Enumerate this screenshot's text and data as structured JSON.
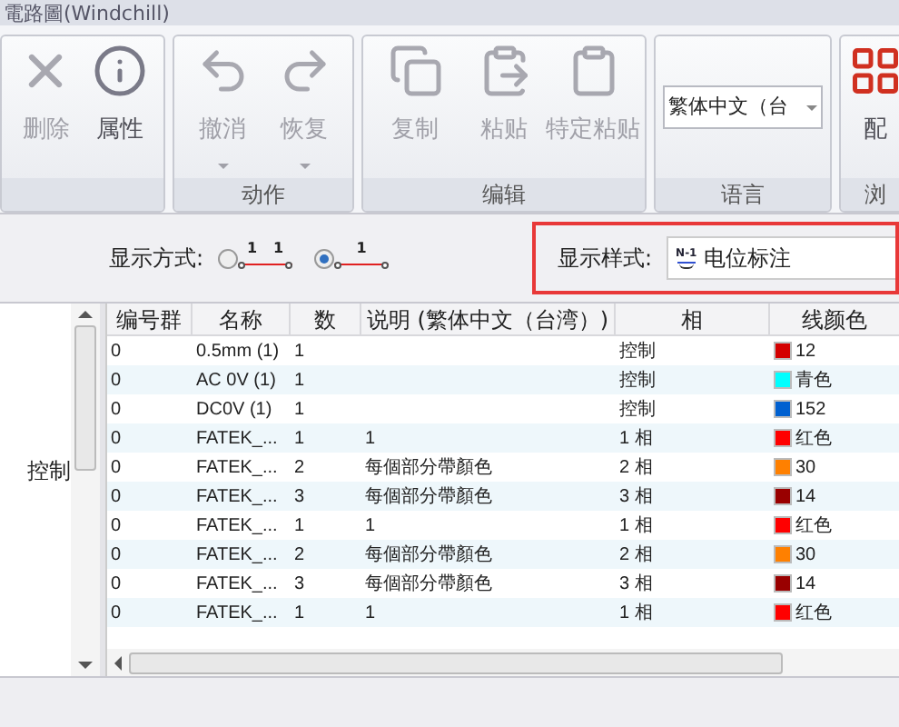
{
  "window": {
    "title": "電路圖(Windchill)"
  },
  "ribbon": {
    "groups": [
      {
        "buttons": [
          {
            "kind": "delete",
            "label": "删除",
            "menu": false,
            "disabled": true
          },
          {
            "kind": "info",
            "label": "属性",
            "menu": false,
            "disabled": false
          }
        ]
      },
      {
        "label": "动作",
        "buttons": [
          {
            "kind": "undo",
            "label": "撤消",
            "menu": true,
            "disabled": true
          },
          {
            "kind": "redo",
            "label": "恢复",
            "menu": true,
            "disabled": true
          }
        ]
      },
      {
        "label": "编辑",
        "buttons": [
          {
            "kind": "copy",
            "label": "复制",
            "menu": false,
            "disabled": true
          },
          {
            "kind": "paste",
            "label": "粘贴",
            "menu": false,
            "disabled": true
          },
          {
            "kind": "paste-special",
            "label": "特定粘贴",
            "menu": false,
            "disabled": true
          }
        ]
      },
      {
        "label": "语言",
        "select": "繁体中文（台"
      },
      {
        "label": "浏",
        "buttons": [
          {
            "kind": "config",
            "label": "配",
            "menu": false,
            "disabled": false
          }
        ]
      }
    ]
  },
  "display_mode": {
    "label": "显示方式:",
    "options": [
      {
        "labels": [
          "1",
          "1"
        ],
        "selected": false
      },
      {
        "labels": [
          "1"
        ],
        "selected": true
      }
    ]
  },
  "display_style": {
    "label": "显示样式:",
    "icon_label": "N-1",
    "value": "电位标注"
  },
  "sidebar": {
    "items": [
      {
        "label": "控制"
      }
    ]
  },
  "table": {
    "columns": [
      "编号群",
      "名称",
      "数",
      "说明 (繁体中文（台湾）)",
      "相",
      "线颜色"
    ],
    "rows": [
      {
        "cells": [
          "0",
          "0.5mm (1)",
          "1",
          "",
          "控制",
          "12"
        ],
        "color": "#d40000"
      },
      {
        "cells": [
          "0",
          "AC 0V (1)",
          "1",
          "",
          "控制",
          "青色"
        ],
        "color": "#00ffff"
      },
      {
        "cells": [
          "0",
          "DC0V (1)",
          "1",
          "",
          "控制",
          "152"
        ],
        "color": "#0060d0"
      },
      {
        "cells": [
          "0",
          "FATEK_...",
          "1",
          "1",
          "1 相",
          "红色"
        ],
        "color": "#ff0000"
      },
      {
        "cells": [
          "0",
          "FATEK_...",
          "2",
          "每個部分帶顏色",
          "2 相",
          "30"
        ],
        "color": "#ff8000"
      },
      {
        "cells": [
          "0",
          "FATEK_...",
          "3",
          "每個部分帶顏色",
          "3 相",
          "14"
        ],
        "color": "#990000"
      },
      {
        "cells": [
          "0",
          "FATEK_...",
          "1",
          "1",
          "1 相",
          "红色"
        ],
        "color": "#ff0000"
      },
      {
        "cells": [
          "0",
          "FATEK_...",
          "2",
          "每個部分帶顏色",
          "2 相",
          "30"
        ],
        "color": "#ff8000"
      },
      {
        "cells": [
          "0",
          "FATEK_...",
          "3",
          "每個部分帶顏色",
          "3 相",
          "14"
        ],
        "color": "#990000"
      },
      {
        "cells": [
          "0",
          "FATEK_...",
          "1",
          "1",
          "1 相",
          "红色"
        ],
        "color": "#ff0000"
      }
    ]
  }
}
